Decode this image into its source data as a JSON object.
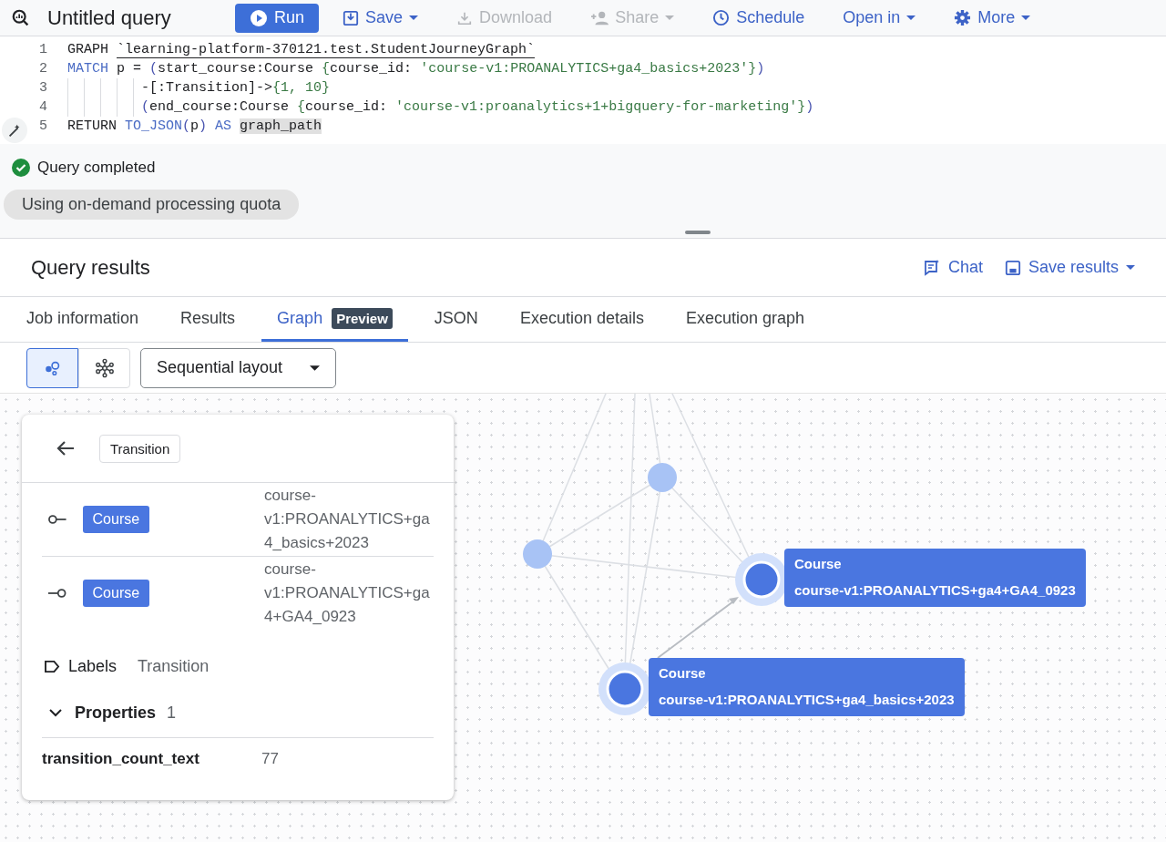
{
  "toolbar": {
    "title": "Untitled query",
    "actions": [
      {
        "label": "Run",
        "primary": true,
        "disabled": false,
        "dropdown": false
      },
      {
        "label": "Save",
        "primary": false,
        "disabled": false,
        "dropdown": true
      },
      {
        "label": "Download",
        "primary": false,
        "disabled": true,
        "dropdown": false
      },
      {
        "label": "Share",
        "primary": false,
        "disabled": true,
        "dropdown": true
      },
      {
        "label": "Schedule",
        "primary": false,
        "disabled": false,
        "dropdown": false
      },
      {
        "label": "Open in",
        "primary": false,
        "disabled": false,
        "dropdown": true
      },
      {
        "label": "More",
        "primary": false,
        "disabled": false,
        "dropdown": true
      }
    ]
  },
  "editor": {
    "lines": [
      {
        "number": "1",
        "tokens": [
          {
            "text": "GRAPH ",
            "kind": "plain"
          },
          {
            "text": "`learning-platform-370121.test.StudentJourneyGraph`",
            "kind": "underlined"
          }
        ]
      },
      {
        "number": "2",
        "tokens": [
          {
            "text": "MATCH",
            "kind": "keyword"
          },
          {
            "text": " p = ",
            "kind": "plain"
          },
          {
            "text": "(",
            "kind": "bracket"
          },
          {
            "text": "start_course:Course ",
            "kind": "plain"
          },
          {
            "text": "{",
            "kind": "brace"
          },
          {
            "text": "course_id: ",
            "kind": "plain"
          },
          {
            "text": "'course-v1:PROANALYTICS+ga4_basics+2023'",
            "kind": "string"
          },
          {
            "text": "}",
            "kind": "brace"
          },
          {
            "text": ")",
            "kind": "bracket"
          }
        ]
      },
      {
        "number": "3",
        "indented": true,
        "tokens": [
          {
            "text": "-[:Transition]->",
            "kind": "plain"
          },
          {
            "text": "{",
            "kind": "brace"
          },
          {
            "text": "1, 10",
            "kind": "string"
          },
          {
            "text": "}",
            "kind": "brace"
          }
        ]
      },
      {
        "number": "4",
        "indented": true,
        "tokens": [
          {
            "text": "(",
            "kind": "bracket"
          },
          {
            "text": "end_course:Course ",
            "kind": "plain"
          },
          {
            "text": "{",
            "kind": "brace"
          },
          {
            "text": "course_id: ",
            "kind": "plain"
          },
          {
            "text": "'course-v1:proanalytics+1+bigquery-for-marketing'",
            "kind": "string"
          },
          {
            "text": "}",
            "kind": "brace"
          },
          {
            "text": ")",
            "kind": "bracket"
          }
        ]
      },
      {
        "number": "5",
        "tokens": [
          {
            "text": "RETURN ",
            "kind": "plain"
          },
          {
            "text": "TO_JSON",
            "kind": "keyword"
          },
          {
            "text": "(",
            "kind": "bracket"
          },
          {
            "text": "p",
            "kind": "plain"
          },
          {
            "text": ")",
            "kind": "bracket"
          },
          {
            "text": " AS ",
            "kind": "keyword"
          },
          {
            "text": "graph_path",
            "kind": "highlight"
          }
        ]
      }
    ]
  },
  "status": {
    "message": "Query completed",
    "success": true,
    "chip": "Using on-demand processing quota"
  },
  "results": {
    "title": "Query results",
    "actions": [
      {
        "label": "Chat",
        "dropdown": false
      },
      {
        "label": "Save results",
        "dropdown": true
      }
    ]
  },
  "tabs": [
    {
      "label": "Job information",
      "selected": false
    },
    {
      "label": "Results",
      "selected": false
    },
    {
      "label": "Graph",
      "selected": true,
      "badge": "Preview"
    },
    {
      "label": "JSON",
      "selected": false
    },
    {
      "label": "Execution details",
      "selected": false
    },
    {
      "label": "Execution graph",
      "selected": false
    }
  ],
  "graph_toolbar": {
    "views": [
      {
        "kind": "nodes",
        "selected": true
      },
      {
        "kind": "network",
        "selected": false
      }
    ],
    "layout": "Sequential layout"
  },
  "detail_panel": {
    "chip": "Transition",
    "endpoints": [
      {
        "kind": "source",
        "label": "Course",
        "value": "course-v1:PROANALYTICS+ga4_basics+2023"
      },
      {
        "kind": "target",
        "label": "Course",
        "value": "course-v1:PROANALYTICS+ga4+GA4_0923"
      }
    ],
    "labels_title": "Labels",
    "labels_value": "Transition",
    "properties_title": "Properties",
    "properties_count": "1",
    "properties_expanded": true,
    "properties": [
      {
        "key": "transition_count_text",
        "value": "77"
      }
    ]
  },
  "graph": {
    "labeled_nodes": [
      {
        "label": "Course",
        "value": "course-v1:PROANALYTICS+ga4+GA4_0923"
      },
      {
        "label": "Course",
        "value": "course-v1:PROANALYTICS+ga4_basics+2023"
      }
    ]
  }
}
